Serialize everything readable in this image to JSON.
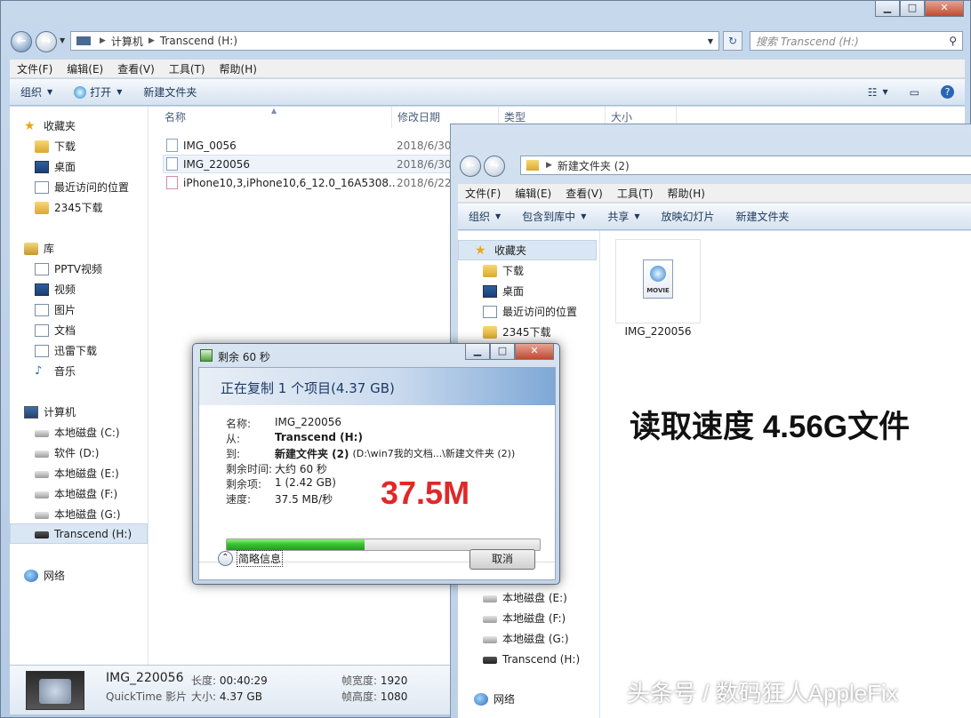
{
  "main": {
    "address_parts": [
      "计算机",
      "Transcend (H:)"
    ],
    "search_placeholder": "搜索 Transcend (H:)",
    "menu": [
      "文件(F)",
      "编辑(E)",
      "查看(V)",
      "工具(T)",
      "帮助(H)"
    ],
    "toolbar": {
      "organize": "组织",
      "open": "打开",
      "new_folder": "新建文件夹"
    },
    "nav": {
      "favorites": "收藏夹",
      "fav_items": [
        "下载",
        "桌面",
        "最近访问的位置",
        "2345下载"
      ],
      "libraries": "库",
      "lib_items": [
        "PPTV视频",
        "视频",
        "图片",
        "文档",
        "迅雷下载",
        "音乐"
      ],
      "computer": "计算机",
      "drives": [
        "本地磁盘 (C:)",
        "软件 (D:)",
        "本地磁盘 (E:)",
        "本地磁盘 (F:)",
        "本地磁盘 (G:)",
        "Transcend (H:)"
      ],
      "network": "网络"
    },
    "columns": {
      "name": "名称",
      "date": "修改日期",
      "type": "类型",
      "size": "大小"
    },
    "files": [
      {
        "name": "IMG_0056",
        "date": "2018/6/30"
      },
      {
        "name": "IMG_220056",
        "date": "2018/6/30"
      },
      {
        "name": "iPhone10,3,iPhone10,6_12.0_16A5308...",
        "date": "2018/6/22"
      }
    ],
    "details": {
      "name": "IMG_220056",
      "kind": "QuickTime 影片",
      "length_label": "长度:",
      "length": "00:40:29",
      "size_label": "大小:",
      "size": "4.37 GB",
      "width_label": "帧宽度:",
      "width": "1920",
      "height_label": "帧高度:",
      "height": "1080"
    }
  },
  "second": {
    "address": "新建文件夹 (2)",
    "menu": [
      "文件(F)",
      "编辑(E)",
      "查看(V)",
      "工具(T)",
      "帮助(H)"
    ],
    "toolbar": [
      "组织",
      "包含到库中",
      "共享",
      "放映幻灯片",
      "新建文件夹"
    ],
    "nav": {
      "favorites": "收藏夹",
      "fav_items": [
        "下载",
        "桌面",
        "最近访问的位置",
        "2345下载"
      ],
      "drives": [
        "本地磁盘 (E:)",
        "本地磁盘 (F:)",
        "本地磁盘 (G:)",
        "Transcend (H:)"
      ],
      "network": "网络"
    },
    "file_icon_label": "MOVIE",
    "file_name": "IMG_220056"
  },
  "dialog": {
    "title": "剩余 60 秒",
    "heading": "正在复制 1 个项目(4.37 GB)",
    "labels": {
      "name": "名称:",
      "from": "从:",
      "to": "到:",
      "time_left": "剩余时间:",
      "items_left": "剩余项:",
      "speed": "速度:"
    },
    "values": {
      "name": "IMG_220056",
      "from": "Transcend (H:)",
      "to_bold": "新建文件夹 (2)",
      "to_path": "(D:\\win7我的文档...\\新建文件夹 (2))",
      "time_left": "大约 60 秒",
      "items_left": "1 (2.42 GB)",
      "speed": "37.5 MB/秒"
    },
    "progress": 0.44,
    "less_info": "简略信息",
    "cancel": "取消"
  },
  "overlay": {
    "title": "读取速度 4.56G文件",
    "speed": "37.5M",
    "watermark": "头条号 / 数码狂人AppleFix"
  },
  "colors": {
    "accent_red": "#e02828",
    "progress_green": "#3ac32d"
  }
}
